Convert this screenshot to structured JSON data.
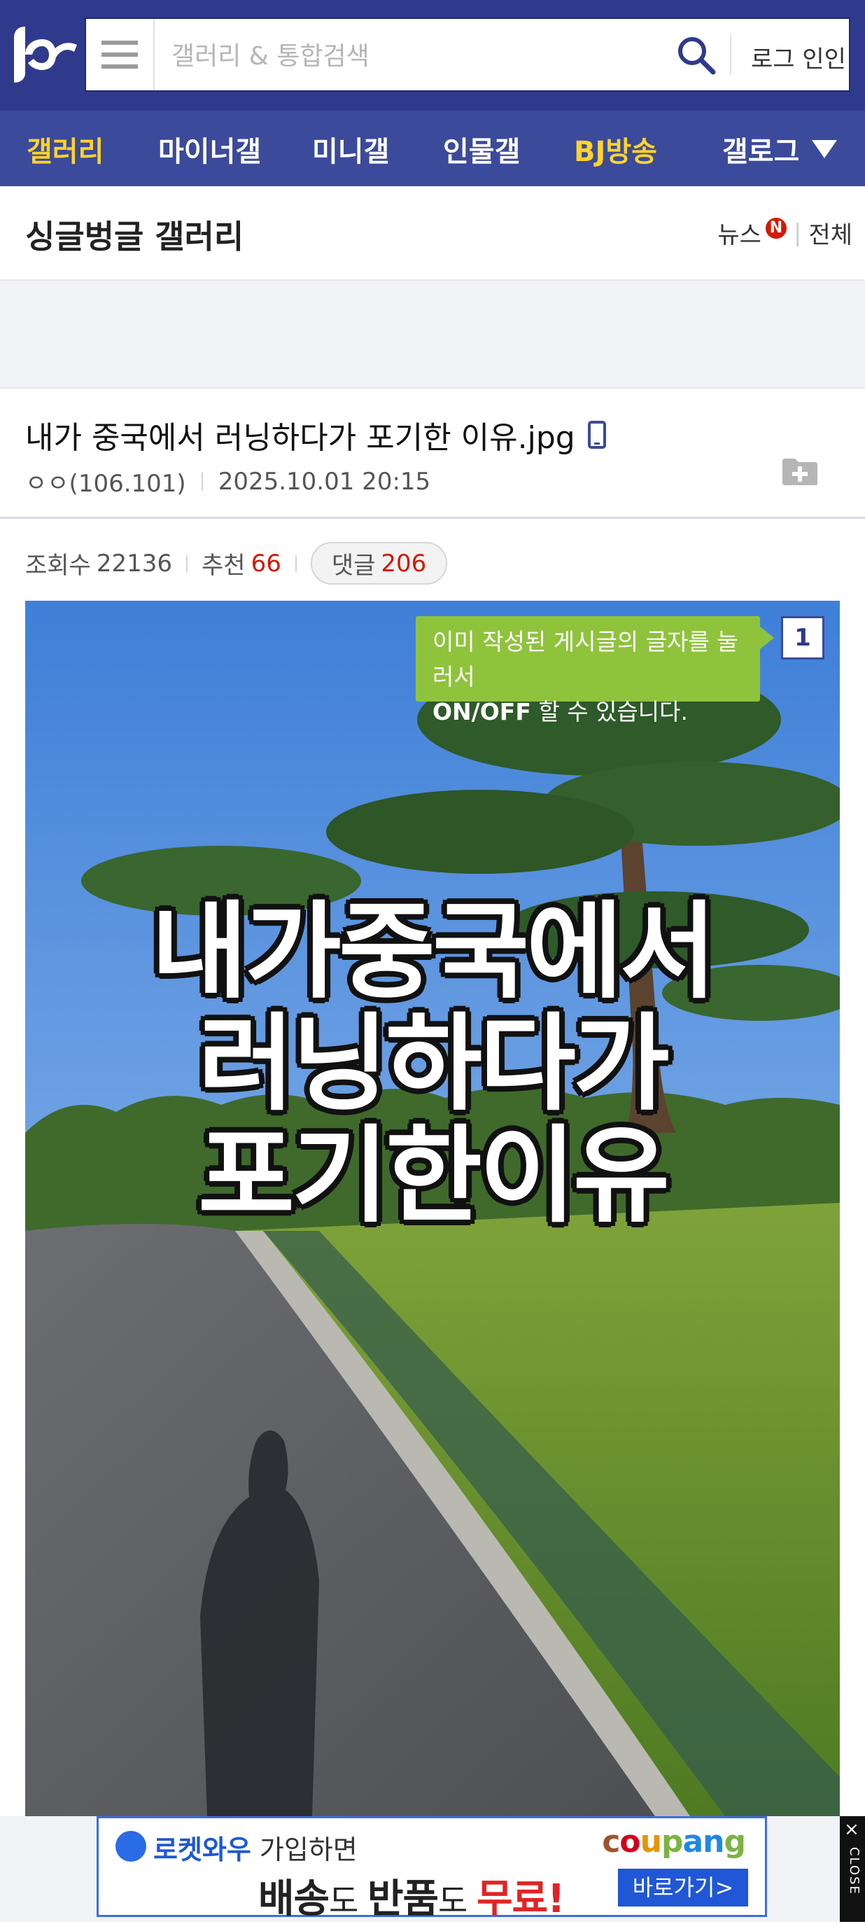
{
  "header": {
    "search_placeholder": "갤러리 & 통합검색",
    "login_label": "로그 인인"
  },
  "nav": {
    "tabs": [
      {
        "label": "갤러리",
        "state": "active"
      },
      {
        "label": "마이너갤",
        "state": "normal"
      },
      {
        "label": "미니갤",
        "state": "normal"
      },
      {
        "label": "인물갤",
        "state": "normal"
      },
      {
        "label": "BJ방송",
        "state": "highlight"
      },
      {
        "label": "갤로그",
        "state": "normal"
      }
    ],
    "colors": {
      "active": "#ffd32a",
      "bar": "#3b4a9a",
      "header": "#2f3a8c"
    }
  },
  "gallery": {
    "title": "싱글벙글 갤러리",
    "news_label": "뉴스",
    "badge": "N",
    "more_label": "전체"
  },
  "post": {
    "title": "내가 중국에서 러닝하다가 포기한 이유.jpg",
    "author": "ㅇㅇ(106.101)",
    "date": "2025.10.01 20:15",
    "views_label": "조회수",
    "views": "22136",
    "recommend_label": "추천",
    "recommend": "66",
    "comments_label": "댓글",
    "comments": "206"
  },
  "image": {
    "overlay_lines": [
      "내가중국에서",
      "러닝하다가",
      "포기한이유"
    ]
  },
  "tooltip": {
    "line1": "이미 작성된 게시글의 글자를 눌러서",
    "line2_bold": "ON/OFF",
    "line2_rest": " 할 수 있습니다.",
    "number": "1"
  },
  "ad": {
    "brand_tag": "로켓와우",
    "line1_rest": " 가입하면",
    "line2_part1": "배송",
    "line2_part2": "도 ",
    "line2_part3": "반품",
    "line2_part4": "도 ",
    "line2_part5": "무료!",
    "brand": "coupang",
    "cta": "바로가기>",
    "close_label": "CLOSE"
  }
}
